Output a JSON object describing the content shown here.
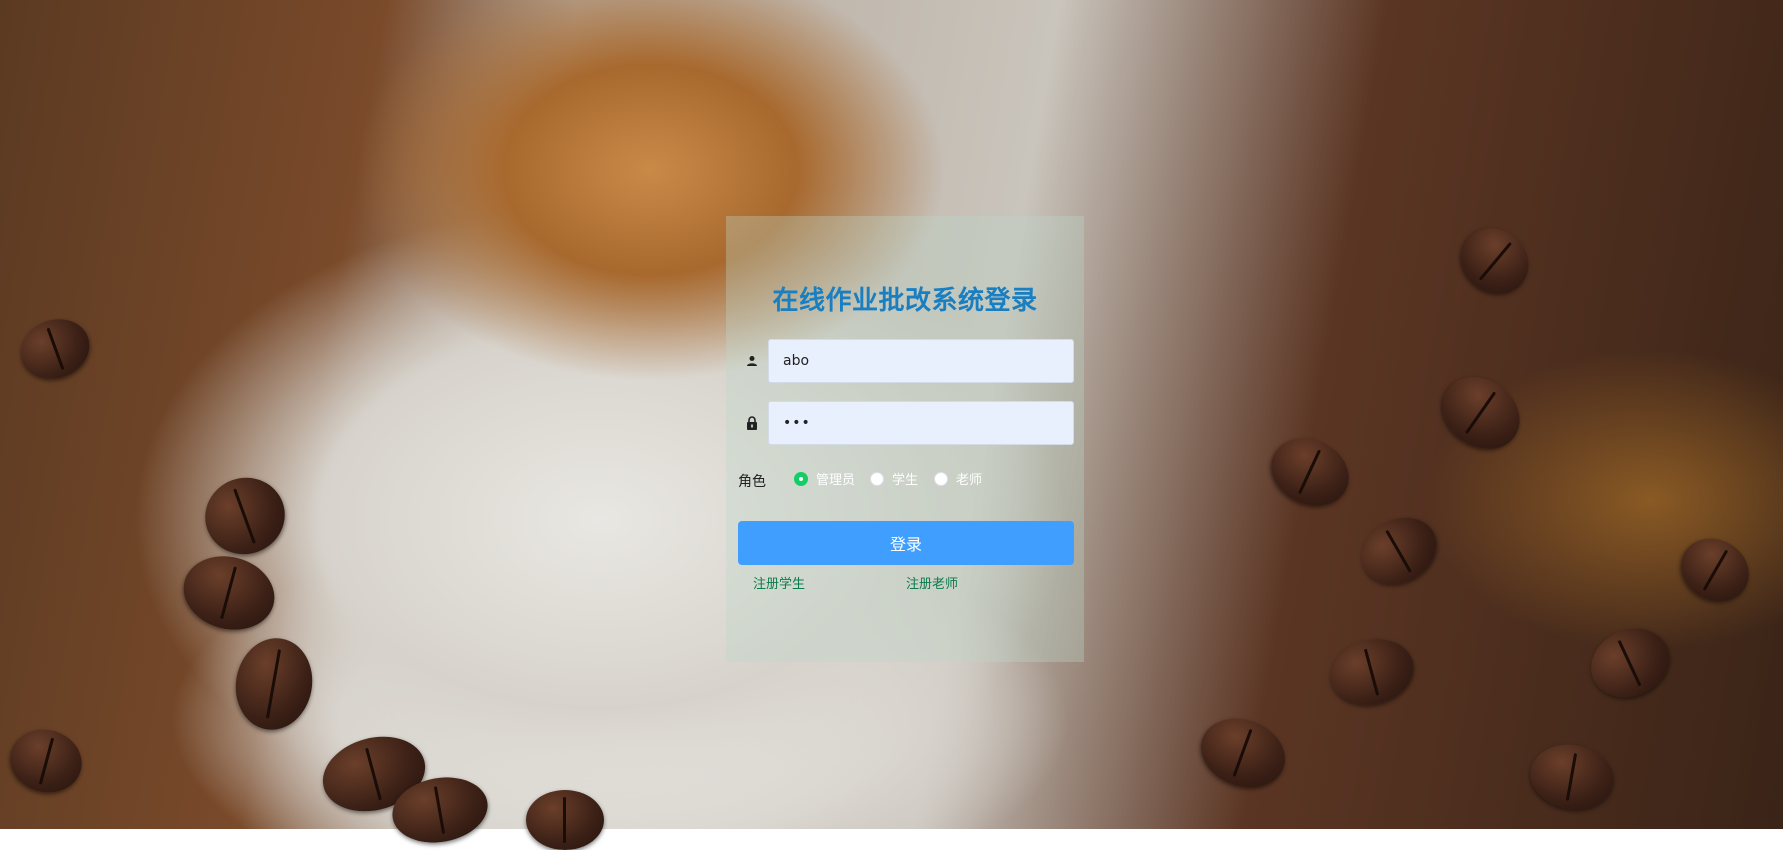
{
  "login": {
    "title": "在线作业批改系统登录",
    "username_value": "abo",
    "password_value": "•••",
    "role_label": "角色",
    "roles": [
      {
        "label": "管理员",
        "checked": true
      },
      {
        "label": "学生",
        "checked": false
      },
      {
        "label": "老师",
        "checked": false
      }
    ],
    "login_button": "登录",
    "register_student": "注册学生",
    "register_teacher": "注册老师"
  },
  "icons": {
    "user": "user-icon",
    "lock": "lock-icon"
  },
  "colors": {
    "title": "#1a7fc1",
    "primary_button": "#409eff",
    "radio_checked": "#13ce66",
    "link": "#0c7a4a",
    "input_bg": "#e8f0fe"
  }
}
